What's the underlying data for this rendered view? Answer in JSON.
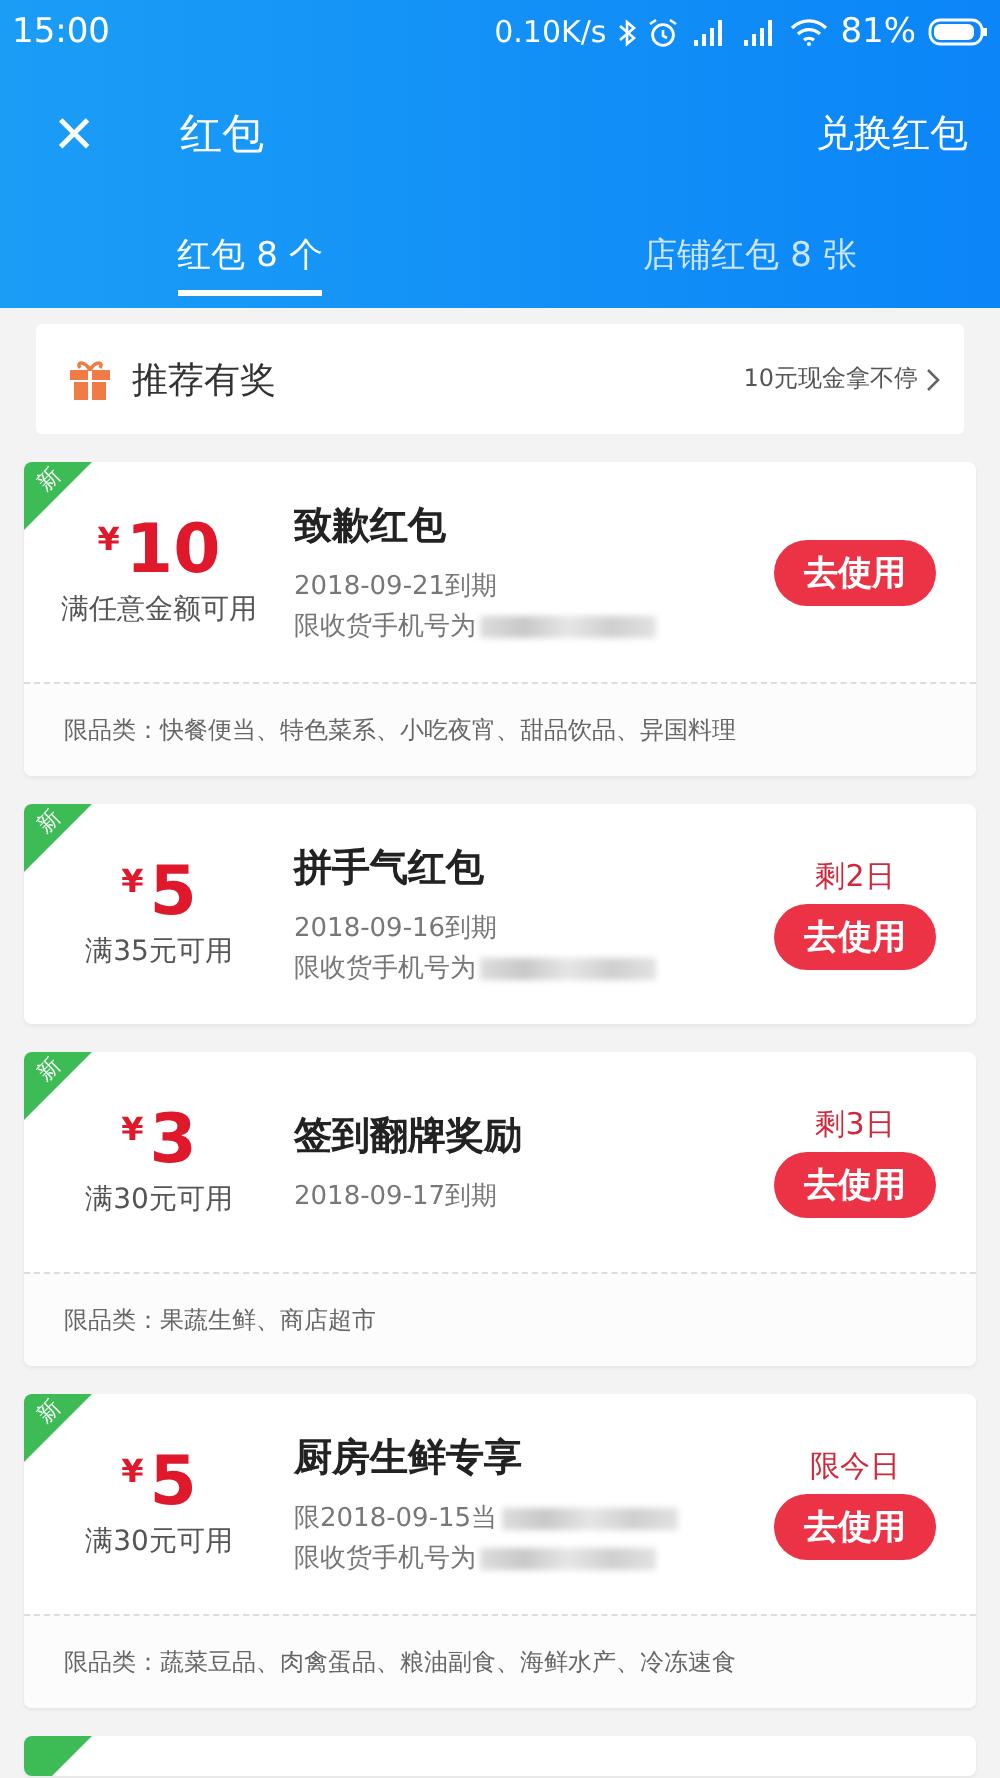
{
  "status_bar": {
    "time": "15:00",
    "speed": "0.10K/s",
    "battery": "81%"
  },
  "header": {
    "close": "×",
    "title": "红包",
    "action": "兑换红包"
  },
  "tabs": [
    {
      "label": "红包 8 个",
      "selected": true
    },
    {
      "label": "店铺红包 8 张",
      "selected": false
    }
  ],
  "promo": {
    "title": "推荐有奖",
    "link": "10元现金拿不停"
  },
  "coupons": [
    {
      "is_new": true,
      "new_label": "新",
      "currency": "¥",
      "amount": "10",
      "condition": "满任意金额可用",
      "title": "致歉红包",
      "lines": [
        {
          "text": "2018-09-21到期",
          "redacted": false
        },
        {
          "text": "限收货手机号为",
          "redacted": true
        }
      ],
      "button": "去使用",
      "category": "限品类：快餐便当、特色菜系、小吃夜宵、甜品饮品、异国料理"
    },
    {
      "is_new": true,
      "new_label": "新",
      "currency": "¥",
      "amount": "5",
      "condition": "满35元可用",
      "title": "拼手气红包",
      "lines": [
        {
          "text": "2018-09-16到期",
          "redacted": false
        },
        {
          "text": "限收货手机号为",
          "redacted": true
        }
      ],
      "badge": "剩2日",
      "button": "去使用"
    },
    {
      "is_new": true,
      "new_label": "新",
      "currency": "¥",
      "amount": "3",
      "condition": "满30元可用",
      "title": "签到翻牌奖励",
      "lines": [
        {
          "text": "2018-09-17到期",
          "redacted": false
        }
      ],
      "badge": "剩3日",
      "button": "去使用",
      "category": "限品类：果蔬生鲜、商店超市"
    },
    {
      "is_new": true,
      "new_label": "新",
      "currency": "¥",
      "amount": "5",
      "condition": "满30元可用",
      "title": "厨房生鲜专享",
      "lines": [
        {
          "text": "限2018-09-15当",
          "redacted": true
        },
        {
          "text": "限收货手机号为",
          "redacted": true
        }
      ],
      "badge": "限今日",
      "button": "去使用",
      "category": "限品类：蔬菜豆品、肉禽蛋品、粮油副食、海鲜水产、冷冻速食"
    }
  ],
  "partial_card": {
    "is_new": true
  }
}
